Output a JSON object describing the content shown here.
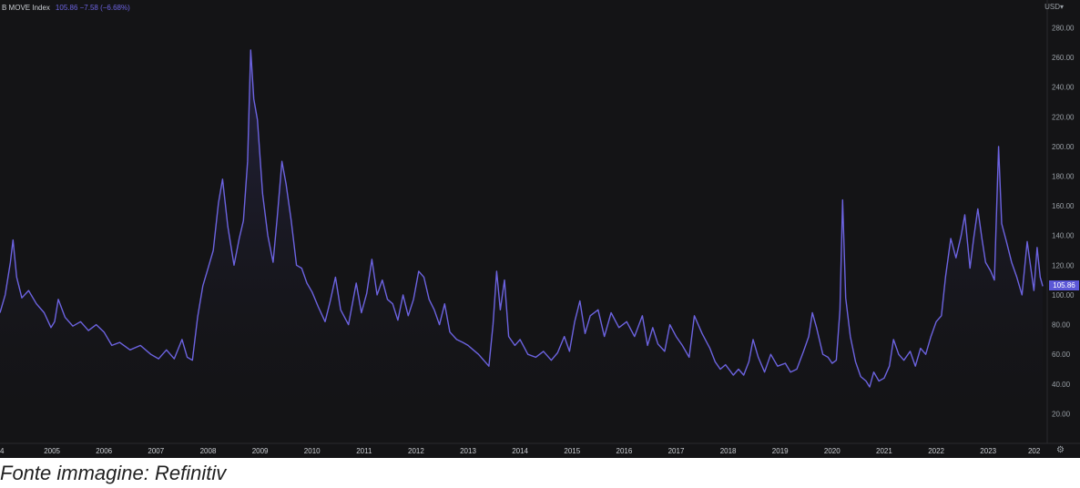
{
  "chart_data": {
    "type": "line",
    "title": "",
    "series": [
      {
        "name": "MOVE Index",
        "points": [
          [
            2004.0,
            88
          ],
          [
            2004.1,
            100
          ],
          [
            2004.2,
            122
          ],
          [
            2004.25,
            137
          ],
          [
            2004.32,
            112
          ],
          [
            2004.42,
            98
          ],
          [
            2004.55,
            103
          ],
          [
            2004.7,
            94
          ],
          [
            2004.85,
            88
          ],
          [
            2004.98,
            78
          ],
          [
            2005.05,
            82
          ],
          [
            2005.12,
            97
          ],
          [
            2005.25,
            85
          ],
          [
            2005.4,
            79
          ],
          [
            2005.55,
            82
          ],
          [
            2005.7,
            76
          ],
          [
            2005.85,
            80
          ],
          [
            2006.0,
            75
          ],
          [
            2006.15,
            66
          ],
          [
            2006.3,
            68
          ],
          [
            2006.5,
            63
          ],
          [
            2006.7,
            66
          ],
          [
            2006.9,
            60
          ],
          [
            2007.05,
            57
          ],
          [
            2007.2,
            63
          ],
          [
            2007.35,
            57
          ],
          [
            2007.5,
            70
          ],
          [
            2007.6,
            58
          ],
          [
            2007.7,
            56
          ],
          [
            2007.8,
            85
          ],
          [
            2007.9,
            106
          ],
          [
            2008.0,
            118
          ],
          [
            2008.1,
            130
          ],
          [
            2008.2,
            162
          ],
          [
            2008.28,
            178
          ],
          [
            2008.38,
            146
          ],
          [
            2008.5,
            120
          ],
          [
            2008.6,
            138
          ],
          [
            2008.68,
            150
          ],
          [
            2008.76,
            190
          ],
          [
            2008.82,
            265
          ],
          [
            2008.88,
            232
          ],
          [
            2008.95,
            218
          ],
          [
            2009.05,
            168
          ],
          [
            2009.15,
            140
          ],
          [
            2009.25,
            122
          ],
          [
            2009.33,
            152
          ],
          [
            2009.42,
            190
          ],
          [
            2009.5,
            175
          ],
          [
            2009.6,
            150
          ],
          [
            2009.7,
            120
          ],
          [
            2009.8,
            118
          ],
          [
            2009.9,
            108
          ],
          [
            2010.0,
            102
          ],
          [
            2010.12,
            92
          ],
          [
            2010.25,
            82
          ],
          [
            2010.35,
            96
          ],
          [
            2010.45,
            112
          ],
          [
            2010.55,
            90
          ],
          [
            2010.7,
            80
          ],
          [
            2010.85,
            108
          ],
          [
            2010.95,
            88
          ],
          [
            2011.05,
            101
          ],
          [
            2011.15,
            124
          ],
          [
            2011.25,
            100
          ],
          [
            2011.35,
            110
          ],
          [
            2011.45,
            97
          ],
          [
            2011.55,
            94
          ],
          [
            2011.65,
            83
          ],
          [
            2011.75,
            100
          ],
          [
            2011.85,
            86
          ],
          [
            2011.95,
            97
          ],
          [
            2012.05,
            116
          ],
          [
            2012.15,
            112
          ],
          [
            2012.25,
            97
          ],
          [
            2012.35,
            90
          ],
          [
            2012.45,
            80
          ],
          [
            2012.55,
            94
          ],
          [
            2012.65,
            75
          ],
          [
            2012.78,
            70
          ],
          [
            2012.9,
            68
          ],
          [
            2013.0,
            66
          ],
          [
            2013.1,
            63
          ],
          [
            2013.2,
            60
          ],
          [
            2013.3,
            56
          ],
          [
            2013.4,
            52
          ],
          [
            2013.48,
            80
          ],
          [
            2013.55,
            116
          ],
          [
            2013.62,
            90
          ],
          [
            2013.7,
            110
          ],
          [
            2013.78,
            72
          ],
          [
            2013.9,
            66
          ],
          [
            2014.0,
            70
          ],
          [
            2014.15,
            60
          ],
          [
            2014.3,
            58
          ],
          [
            2014.45,
            62
          ],
          [
            2014.6,
            56
          ],
          [
            2014.72,
            61
          ],
          [
            2014.85,
            72
          ],
          [
            2014.95,
            62
          ],
          [
            2015.05,
            82
          ],
          [
            2015.15,
            96
          ],
          [
            2015.25,
            74
          ],
          [
            2015.35,
            86
          ],
          [
            2015.5,
            90
          ],
          [
            2015.62,
            72
          ],
          [
            2015.75,
            88
          ],
          [
            2015.9,
            78
          ],
          [
            2016.05,
            82
          ],
          [
            2016.2,
            72
          ],
          [
            2016.35,
            86
          ],
          [
            2016.45,
            66
          ],
          [
            2016.55,
            78
          ],
          [
            2016.65,
            67
          ],
          [
            2016.78,
            62
          ],
          [
            2016.88,
            80
          ],
          [
            2017.0,
            72
          ],
          [
            2017.12,
            66
          ],
          [
            2017.25,
            58
          ],
          [
            2017.35,
            86
          ],
          [
            2017.5,
            74
          ],
          [
            2017.65,
            64
          ],
          [
            2017.75,
            55
          ],
          [
            2017.85,
            50
          ],
          [
            2017.95,
            53
          ],
          [
            2018.1,
            46
          ],
          [
            2018.2,
            50
          ],
          [
            2018.3,
            46
          ],
          [
            2018.4,
            55
          ],
          [
            2018.48,
            70
          ],
          [
            2018.58,
            58
          ],
          [
            2018.7,
            48
          ],
          [
            2018.82,
            60
          ],
          [
            2018.95,
            52
          ],
          [
            2019.1,
            54
          ],
          [
            2019.2,
            48
          ],
          [
            2019.32,
            50
          ],
          [
            2019.45,
            62
          ],
          [
            2019.55,
            72
          ],
          [
            2019.62,
            88
          ],
          [
            2019.7,
            78
          ],
          [
            2019.82,
            60
          ],
          [
            2019.92,
            58
          ],
          [
            2020.0,
            54
          ],
          [
            2020.08,
            56
          ],
          [
            2020.15,
            90
          ],
          [
            2020.2,
            164
          ],
          [
            2020.26,
            98
          ],
          [
            2020.35,
            72
          ],
          [
            2020.45,
            55
          ],
          [
            2020.55,
            45
          ],
          [
            2020.65,
            42
          ],
          [
            2020.72,
            38
          ],
          [
            2020.8,
            48
          ],
          [
            2020.9,
            42
          ],
          [
            2021.0,
            44
          ],
          [
            2021.1,
            52
          ],
          [
            2021.18,
            70
          ],
          [
            2021.28,
            60
          ],
          [
            2021.38,
            56
          ],
          [
            2021.5,
            62
          ],
          [
            2021.6,
            52
          ],
          [
            2021.7,
            64
          ],
          [
            2021.8,
            60
          ],
          [
            2021.9,
            72
          ],
          [
            2022.0,
            82
          ],
          [
            2022.1,
            86
          ],
          [
            2022.18,
            112
          ],
          [
            2022.28,
            138
          ],
          [
            2022.38,
            125
          ],
          [
            2022.48,
            140
          ],
          [
            2022.55,
            154
          ],
          [
            2022.65,
            118
          ],
          [
            2022.72,
            138
          ],
          [
            2022.8,
            158
          ],
          [
            2022.88,
            138
          ],
          [
            2022.95,
            122
          ],
          [
            2023.05,
            116
          ],
          [
            2023.12,
            110
          ],
          [
            2023.2,
            200
          ],
          [
            2023.26,
            148
          ],
          [
            2023.35,
            136
          ],
          [
            2023.45,
            122
          ],
          [
            2023.55,
            112
          ],
          [
            2023.65,
            100
          ],
          [
            2023.75,
            136
          ],
          [
            2023.82,
            118
          ],
          [
            2023.88,
            103
          ],
          [
            2023.94,
            132
          ],
          [
            2024.0,
            112
          ],
          [
            2024.05,
            105.86
          ]
        ]
      }
    ],
    "x_ticks": [
      {
        "value": 2004,
        "label": "4"
      },
      {
        "value": 2005,
        "label": "2005"
      },
      {
        "value": 2006,
        "label": "2006"
      },
      {
        "value": 2007,
        "label": "2007"
      },
      {
        "value": 2008,
        "label": "2008"
      },
      {
        "value": 2009,
        "label": "2009"
      },
      {
        "value": 2010,
        "label": "2010"
      },
      {
        "value": 2011,
        "label": "2011"
      },
      {
        "value": 2012,
        "label": "2012"
      },
      {
        "value": 2013,
        "label": "2013"
      },
      {
        "value": 2014,
        "label": "2014"
      },
      {
        "value": 2015,
        "label": "2015"
      },
      {
        "value": 2016,
        "label": "2016"
      },
      {
        "value": 2017,
        "label": "2017"
      },
      {
        "value": 2018,
        "label": "2018"
      },
      {
        "value": 2019,
        "label": "2019"
      },
      {
        "value": 2020,
        "label": "2020"
      },
      {
        "value": 2021,
        "label": "2021"
      },
      {
        "value": 2022,
        "label": "2022"
      },
      {
        "value": 2023,
        "label": "2023"
      },
      {
        "value": 2024,
        "label": "202"
      }
    ],
    "y_ticks": [
      20,
      40,
      60,
      80,
      100,
      120,
      140,
      160,
      180,
      200,
      220,
      240,
      260,
      280
    ],
    "y_tick_labels": [
      "20.00",
      "40.00",
      "60.00",
      "80.00",
      "100.00",
      "120.00",
      "140.00",
      "160.00",
      "180.00",
      "200.00",
      "220.00",
      "240.00",
      "260.00",
      "280.00"
    ],
    "ylim": [
      0,
      295
    ],
    "xlim": [
      2004.0,
      2024.1
    ],
    "grid": false,
    "colors": {
      "line": "#6c63e0",
      "background": "#141416",
      "badge": "#5b57d6"
    }
  },
  "legend": {
    "name": "B MOVE Index",
    "value": "105.86 −7.58 (−6.68%)"
  },
  "currency_label": "USD▾",
  "last_value_label": "105.86",
  "last_value": 105.86,
  "settings_icon": "gear-icon",
  "caption": "Fonte immagine: Refinitiv"
}
